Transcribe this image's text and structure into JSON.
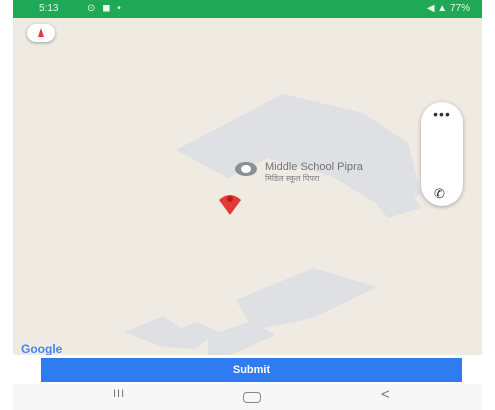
{
  "status_bar": {
    "time": "5:13",
    "notification_icons": "⊙ ◼ •",
    "right_text": "◀ ▲ 77%"
  },
  "map": {
    "poi": {
      "name": "Middle School Pipra",
      "subtitle": "मिडिल स्कूल पिपरा"
    },
    "logo": "Google",
    "panel": {
      "more": "•••",
      "phone": "✆"
    },
    "colors": {
      "land": "#efebe2",
      "building": "#dfe0e4",
      "marker": "#e53935"
    }
  },
  "submit": {
    "label": "Submit",
    "color": "#2f7bf0"
  },
  "nav": {
    "recent": "III",
    "back": "<"
  }
}
